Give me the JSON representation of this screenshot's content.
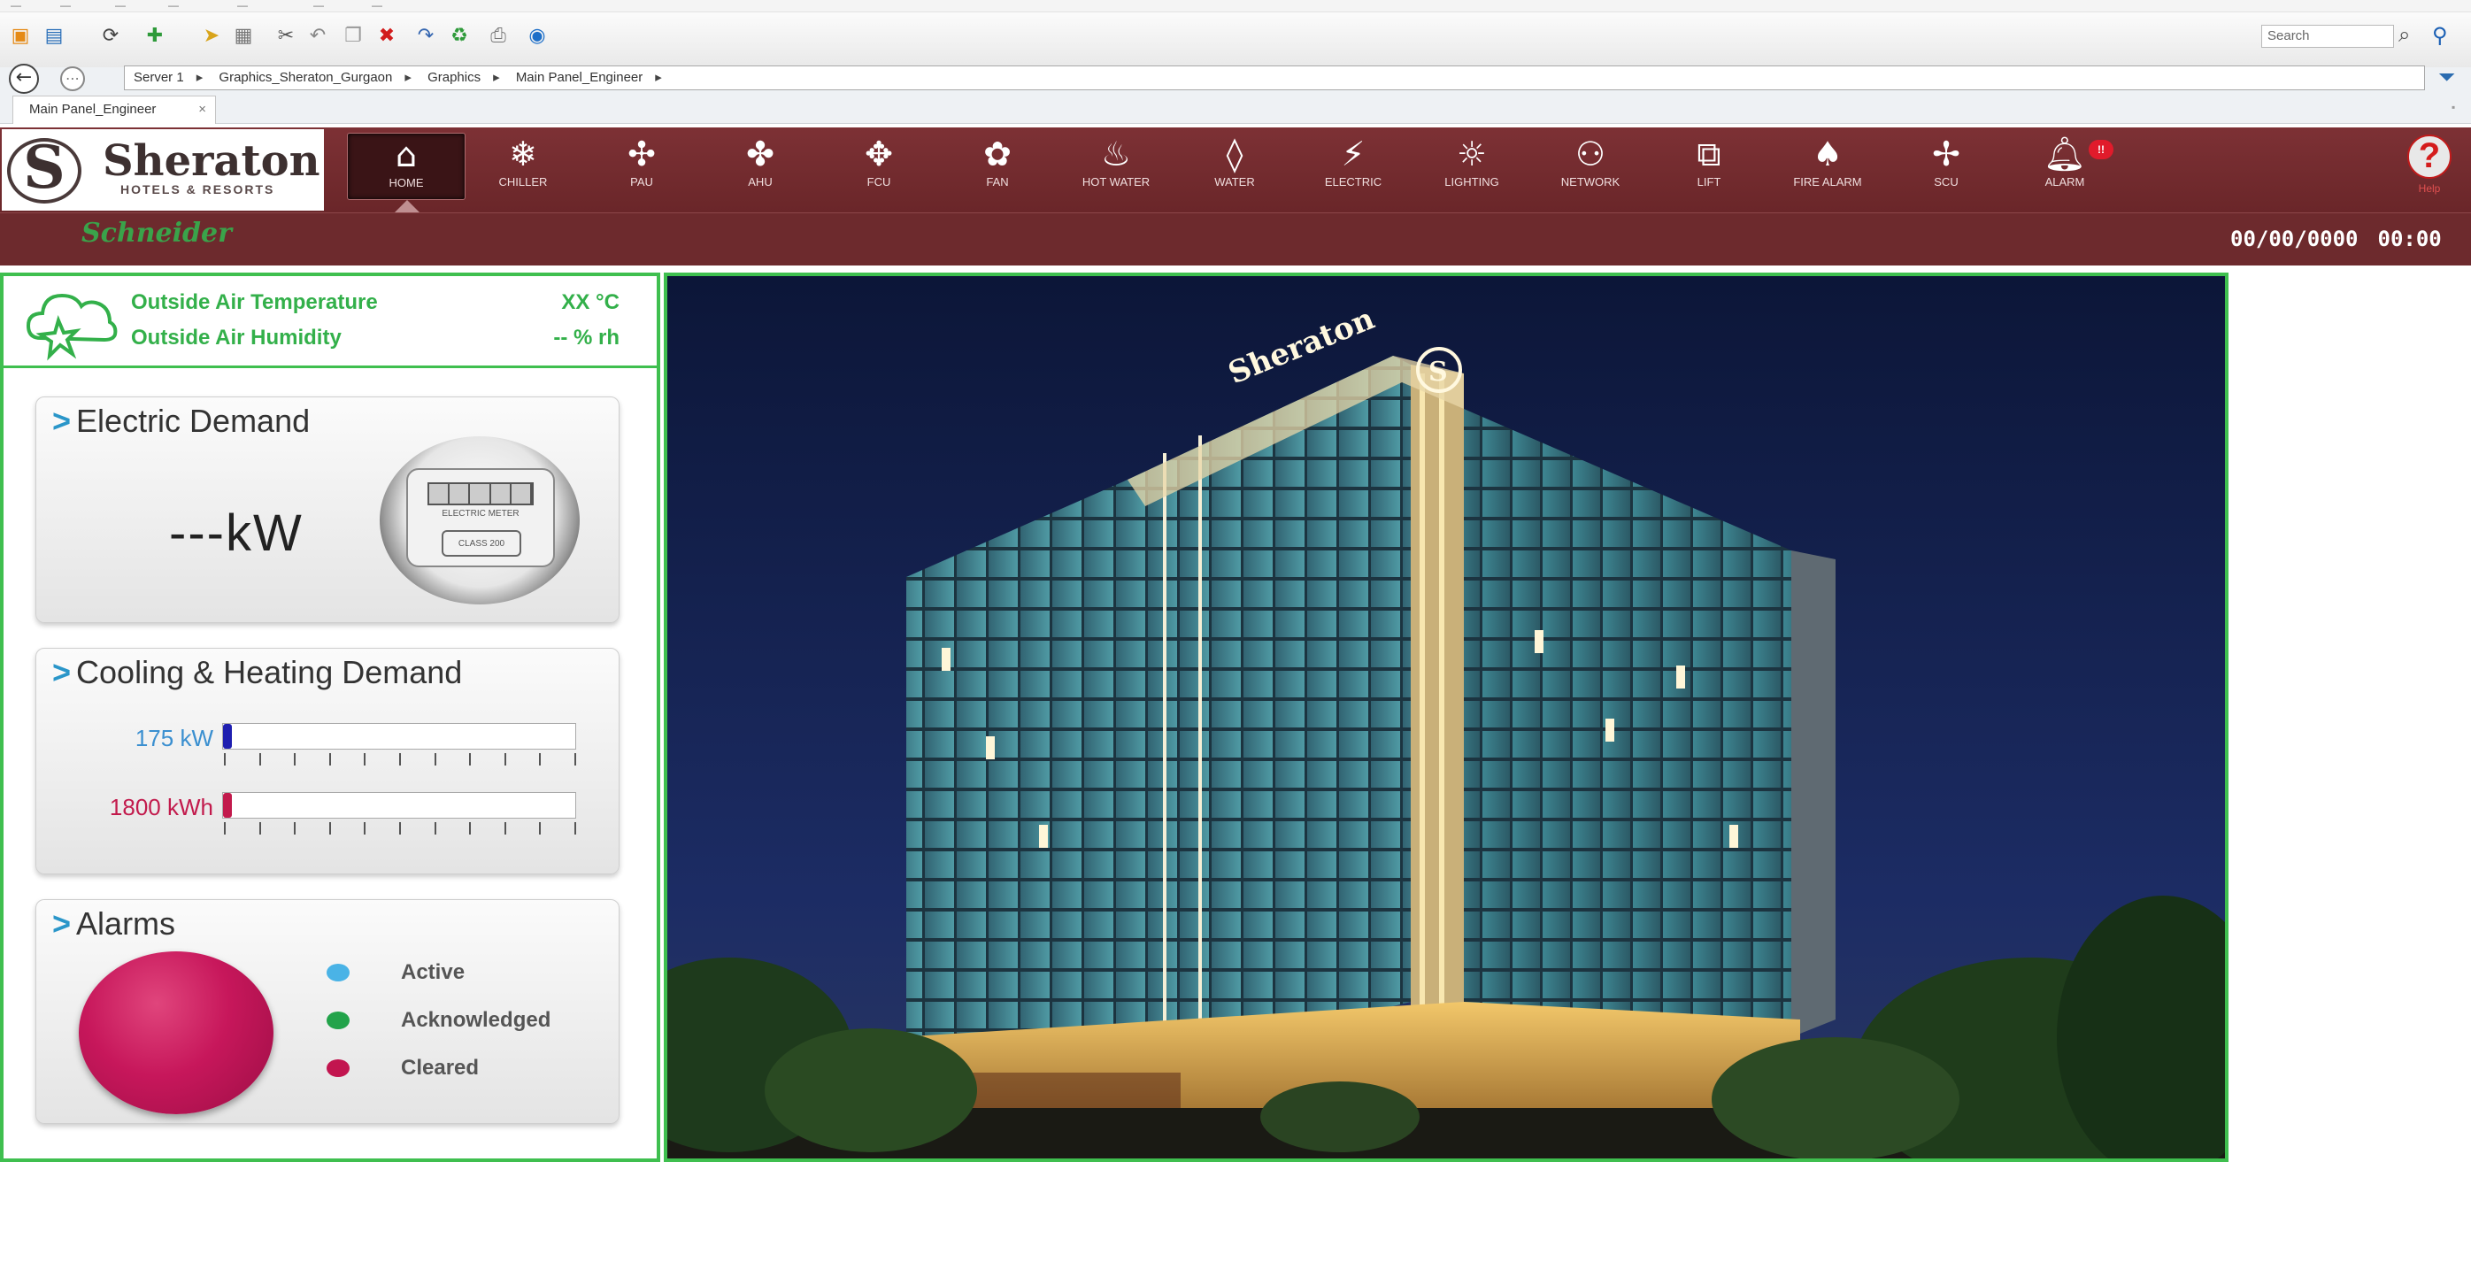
{
  "menubar": {
    "items": [
      "—",
      "—",
      "—",
      "—",
      "—",
      "—",
      "—"
    ]
  },
  "toolbar": {
    "icons": [
      "folder-icon",
      "window-icon",
      "refresh-icon",
      "add-icon",
      "open-icon",
      "save-icon",
      "cut-icon",
      "undo-icon",
      "copy-icon",
      "delete-icon",
      "redo-icon",
      "reload-icon",
      "print-icon",
      "globe-icon"
    ],
    "search_placeholder": "Search"
  },
  "address": {
    "crumbs": [
      "Server 1",
      "Graphics_Sheraton_Gurgaon",
      "Graphics",
      "Main Panel_Engineer"
    ]
  },
  "tab": {
    "label": "Main Panel_Engineer",
    "close": "×"
  },
  "brand": {
    "name": "Sheraton",
    "tagline": "HOTELS & RESORTS",
    "vendor": "Schneider"
  },
  "nav": {
    "items": [
      {
        "label": "HOME",
        "icon": "home-icon"
      },
      {
        "label": "CHILLER",
        "icon": "snowflake-icon"
      },
      {
        "label": "PAU",
        "icon": "fan-icon"
      },
      {
        "label": "AHU",
        "icon": "fan-icon"
      },
      {
        "label": "FCU",
        "icon": "fan-icon"
      },
      {
        "label": "FAN",
        "icon": "fan-icon"
      },
      {
        "label": "HOT WATER",
        "icon": "heat-icon"
      },
      {
        "label": "WATER",
        "icon": "droplet-icon"
      },
      {
        "label": "ELECTRIC",
        "icon": "lightning-icon"
      },
      {
        "label": "LIGHTING",
        "icon": "bulb-icon"
      },
      {
        "label": "NETWORK",
        "icon": "network-icon"
      },
      {
        "label": "LIFT",
        "icon": "lift-icon"
      },
      {
        "label": "FIRE ALARM",
        "icon": "fire-icon"
      },
      {
        "label": "SCU",
        "icon": "fan-icon"
      },
      {
        "label": "ALARM",
        "icon": "bell-icon"
      }
    ],
    "alarm_badge": "!!",
    "help_label": "Help"
  },
  "datetime": {
    "date": "00/00/0000",
    "time": "00:00"
  },
  "weather": {
    "temp_label": "Outside Air Temperature",
    "temp_value": "XX °C",
    "humidity_label": "Outside Air Humidity",
    "humidity_value": "-- % rh"
  },
  "electric": {
    "title": "Electric Demand",
    "value": "---kW",
    "meter_brand": "ELECTRIC METER",
    "meter_base": "CLASS 200"
  },
  "cooling": {
    "title": "Cooling & Heating Demand",
    "bars": [
      {
        "label": "175 kW",
        "fill_fraction": 0.02,
        "color": "#1f1fb0",
        "label_color": "#3a8fd0"
      },
      {
        "label": "1800 kWh",
        "fill_fraction": 0.02,
        "color": "#c21a4c",
        "label_color": "#c21a4c"
      }
    ]
  },
  "alarms": {
    "title": "Alarms",
    "legend": [
      {
        "label": "Active",
        "color": "#4ab3e6"
      },
      {
        "label": "Acknowledged",
        "color": "#22a34a"
      },
      {
        "label": "Cleared",
        "color": "#c2154f"
      }
    ]
  },
  "hero": {
    "sign": "Sheraton",
    "emblem": "S"
  },
  "colors": {
    "header": "#722b2e",
    "accent_green": "#3fbf4f",
    "panel_text_green": "#33b04a"
  }
}
